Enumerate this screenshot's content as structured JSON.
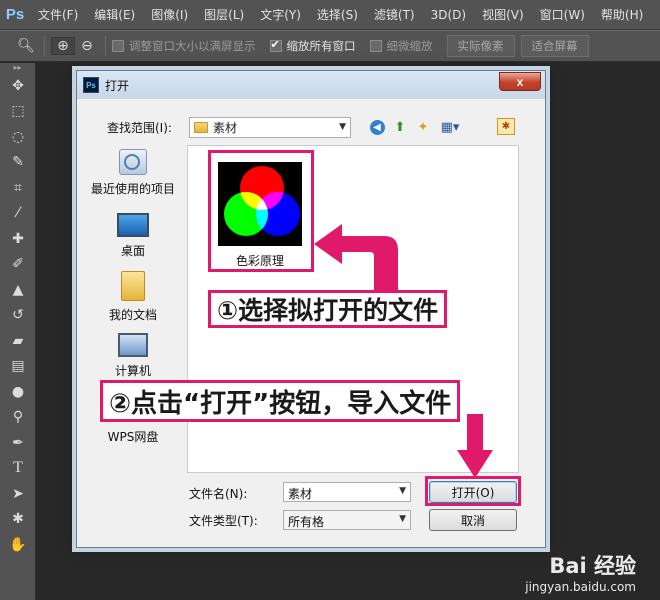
{
  "app": {
    "logo": "Ps"
  },
  "menubar": {
    "items": [
      "文件(F)",
      "编辑(E)",
      "图像(I)",
      "图层(L)",
      "文字(Y)",
      "选择(S)",
      "滤镜(T)",
      "3D(D)",
      "视图(V)",
      "窗口(W)",
      "帮助(H)"
    ]
  },
  "options": {
    "resize_window": "调整窗口大小以满屏显示",
    "zoom_all": "缩放所有窗口",
    "scrubby_zoom": "细微缩放",
    "actual_pixels": "实际像素",
    "fit_screen": "适合屏幕"
  },
  "dialog": {
    "title": "打开",
    "close_label": "x",
    "look_in_label": "查找范围(I):",
    "look_in_value": "素材",
    "places": [
      {
        "label": "最近使用的项目",
        "icon": "recent-icon"
      },
      {
        "label": "桌面",
        "icon": "desktop-icon"
      },
      {
        "label": "我的文档",
        "icon": "documents-icon"
      },
      {
        "label": "计算机",
        "icon": "computer-icon"
      },
      {
        "label": "WPS网盘",
        "icon": "wps-cloud-icon"
      }
    ],
    "files": [
      {
        "name": "色彩原理"
      }
    ],
    "filename_label": "文件名(N):",
    "filename_value": "素材",
    "filetype_label": "文件类型(T):",
    "filetype_value": "所有格",
    "open_button": "打开(O)",
    "cancel_button": "取消"
  },
  "annotations": {
    "step1": "①选择拟打开的文件",
    "step2": "②点击“打开”按钮，导入文件",
    "highlight_color": "#e0196b"
  },
  "watermark": {
    "logo": "Bai  经验",
    "url": "jingyan.baidu.com"
  }
}
